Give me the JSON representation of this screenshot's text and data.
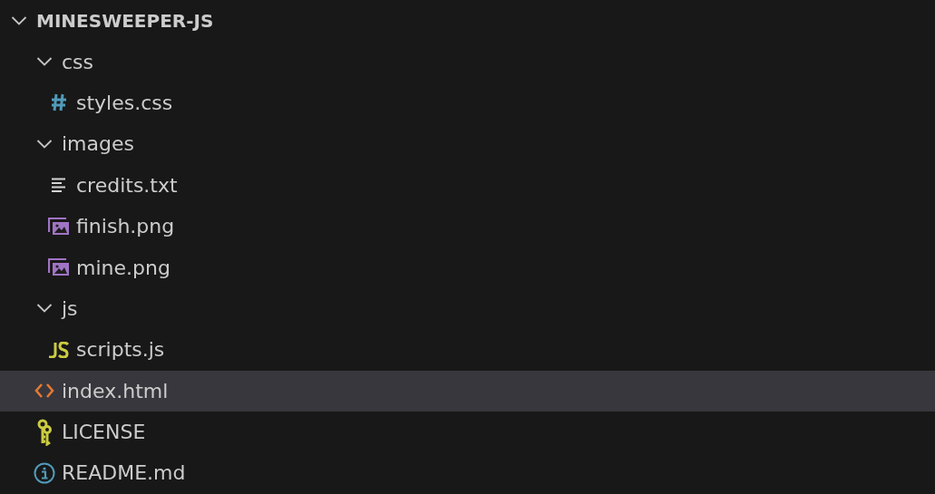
{
  "explorer": {
    "root": {
      "label": "MINESWEEPER-JS",
      "expanded": true,
      "selected": false,
      "children": [
        {
          "label": "css",
          "kind": "folder",
          "expanded": true,
          "selected": false,
          "children": [
            {
              "label": "styles.css",
              "kind": "css",
              "selected": false
            }
          ]
        },
        {
          "label": "images",
          "kind": "folder",
          "expanded": true,
          "selected": false,
          "children": [
            {
              "label": "credits.txt",
              "kind": "text",
              "selected": false
            },
            {
              "label": "finish.png",
              "kind": "image",
              "selected": false
            },
            {
              "label": "mine.png",
              "kind": "image",
              "selected": false
            }
          ]
        },
        {
          "label": "js",
          "kind": "folder",
          "expanded": true,
          "selected": false,
          "children": [
            {
              "label": "scripts.js",
              "kind": "js",
              "selected": false
            }
          ]
        },
        {
          "label": "index.html",
          "kind": "html",
          "selected": true
        },
        {
          "label": "LICENSE",
          "kind": "license",
          "selected": false
        },
        {
          "label": "README.md",
          "kind": "info",
          "selected": false
        }
      ]
    }
  }
}
